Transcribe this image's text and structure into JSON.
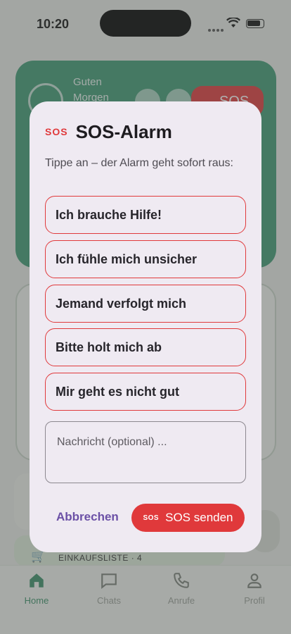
{
  "status_bar": {
    "time": "10:20"
  },
  "background": {
    "greeting": "Guten Morgen",
    "sos_button_label": "SOS",
    "shopping_label": "EINKAUFSLISTE · 4"
  },
  "tab_bar": {
    "tabs": [
      {
        "label": "Home",
        "icon": "home-icon",
        "active": true
      },
      {
        "label": "Chats",
        "icon": "chat-icon",
        "active": false
      },
      {
        "label": "Anrufe",
        "icon": "phone-icon",
        "active": false
      },
      {
        "label": "Profil",
        "icon": "person-icon",
        "active": false
      }
    ]
  },
  "dialog": {
    "icon_text": "SOS",
    "title": "SOS-Alarm",
    "subtitle": "Tippe an – der Alarm geht sofort raus:",
    "options": [
      "Ich brauche Hilfe!",
      "Ich fühle mich unsicher",
      "Jemand verfolgt mich",
      "Bitte holt mich ab",
      "Mir geht es nicht gut"
    ],
    "message_placeholder": "Nachricht (optional) ...",
    "cancel_label": "Abbrechen",
    "send_icon_text": "SOS",
    "send_label": "SOS senden"
  },
  "colors": {
    "accent_red": "#e0393b",
    "brand_green": "#3f9a74",
    "cancel_purple": "#6b50a6",
    "dialog_bg": "#efeaf2"
  }
}
